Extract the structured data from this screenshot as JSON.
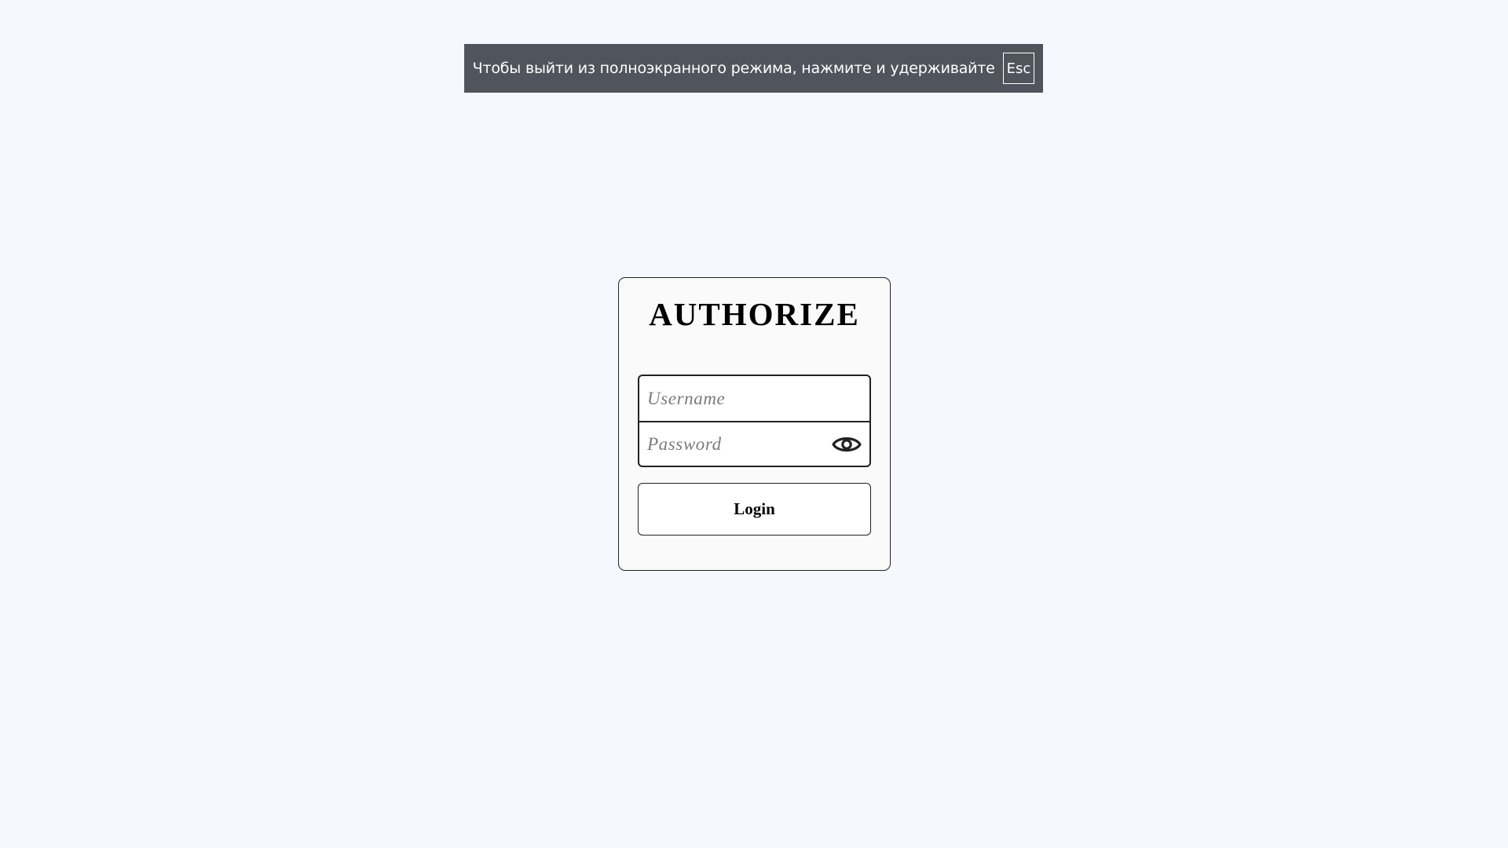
{
  "fullscreen_banner": {
    "message": "Чтобы выйти из полноэкранного режима, нажмите и удерживайте",
    "key": "Esc"
  },
  "auth": {
    "title": "AUTHORIZE",
    "username": {
      "value": "",
      "placeholder": "Username"
    },
    "password": {
      "value": "",
      "placeholder": "Password",
      "toggle_icon": "eye-icon"
    },
    "login_label": "Login"
  },
  "colors": {
    "background": "#f5f8fe",
    "banner_background": "#50555d",
    "card_background": "#fafafa",
    "border": "#222222"
  }
}
